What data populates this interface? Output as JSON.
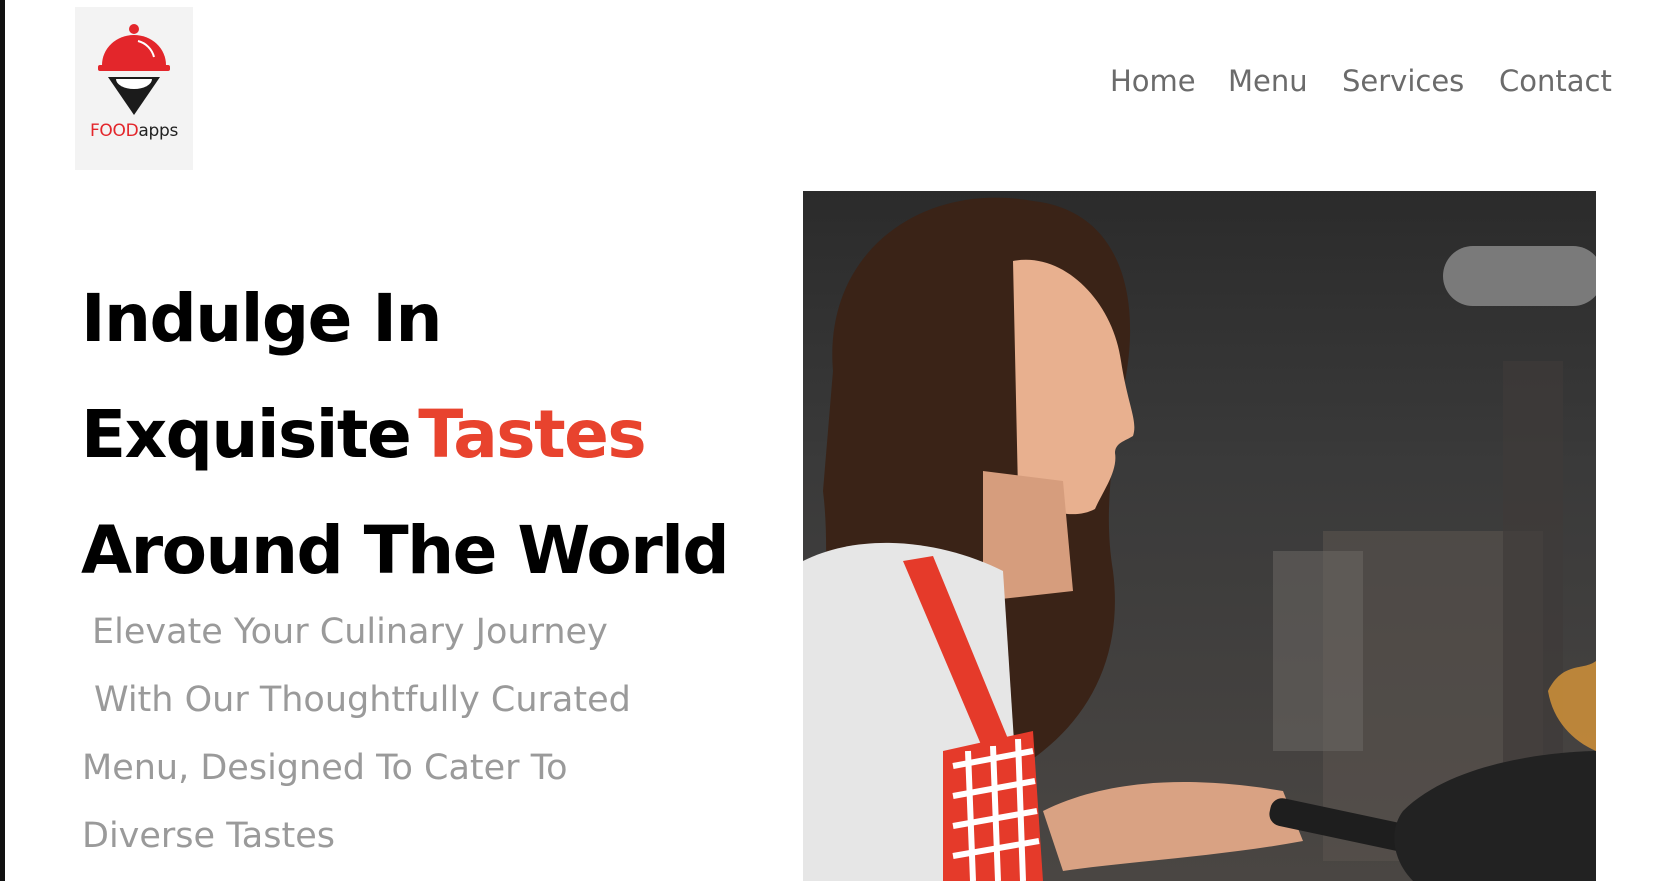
{
  "logo": {
    "brand_food": "FOOD",
    "brand_apps": "apps"
  },
  "nav": {
    "home": "Home",
    "menu": "Menu",
    "services": "Services",
    "contact": "Contact"
  },
  "hero": {
    "line1": "Indulge In",
    "line2_prefix": "Exquisite",
    "line2_accent": "Tastes",
    "line3": "Around The World",
    "subtitle_lines": [
      "Elevate Your Culinary Journey",
      "With Our Thoughtfully Curated",
      "Menu, Designed To Cater To",
      "Diverse Tastes"
    ]
  },
  "colors": {
    "accent": "#e8432e",
    "logo_red": "#e3262b",
    "nav_text": "#6b6b6b",
    "subtitle_text": "#9a9a9a"
  },
  "icons": {
    "logo": "cloche-pin-icon"
  }
}
